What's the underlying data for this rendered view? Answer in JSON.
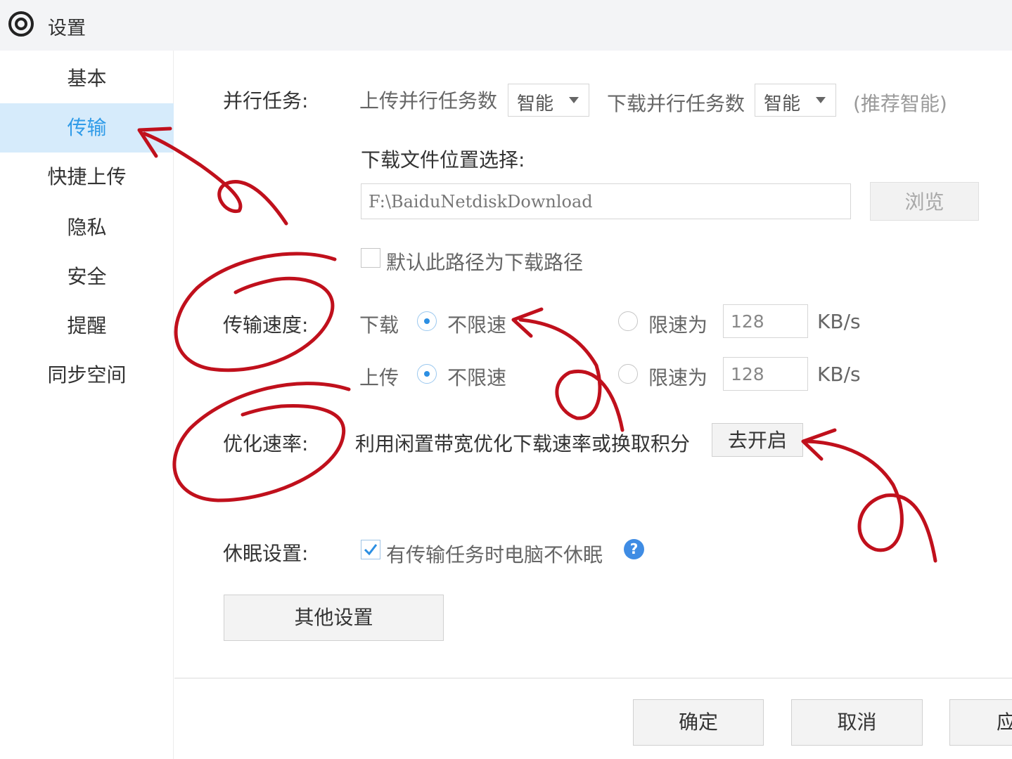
{
  "window": {
    "title": "设置"
  },
  "sidebar": {
    "items": [
      {
        "label": "基本",
        "active": false
      },
      {
        "label": "传输",
        "active": true
      },
      {
        "label": "快捷上传",
        "active": false
      },
      {
        "label": "隐私",
        "active": false
      },
      {
        "label": "安全",
        "active": false
      },
      {
        "label": "提醒",
        "active": false
      },
      {
        "label": "同步空间",
        "active": false
      }
    ]
  },
  "parallel": {
    "label": "并行任务:",
    "upload_label": "上传并行任务数",
    "upload_value": "智能",
    "download_label": "下载并行任务数",
    "download_value": "智能",
    "hint": "(推荐智能)"
  },
  "download_location": {
    "label": "下载文件位置选择:",
    "path": "F:\\BaiduNetdiskDownload",
    "browse_button": "浏览",
    "default_checkbox_label": "默认此路径为下载路径",
    "default_checked": false
  },
  "speed": {
    "label": "传输速度:",
    "download": {
      "label": "下载",
      "unlimited_label": "不限速",
      "limit_label": "限速为",
      "limit_value": "128",
      "unit": "KB/s",
      "selected": "unlimited"
    },
    "upload": {
      "label": "上传",
      "unlimited_label": "不限速",
      "limit_label": "限速为",
      "limit_value": "128",
      "unit": "KB/s",
      "selected": "unlimited"
    }
  },
  "optimize": {
    "label": "优化速率:",
    "description": "利用闲置带宽优化下载速率或换取积分",
    "button": "去开启"
  },
  "sleep": {
    "label": "休眠设置:",
    "checkbox_label": "有传输任务时电脑不休眠",
    "checked": true,
    "help_icon": "?"
  },
  "other_settings_button": "其他设置",
  "footer": {
    "ok": "确定",
    "cancel": "取消",
    "apply": "应用"
  },
  "colors": {
    "accent": "#2f9be8",
    "active_bg": "#d6ebfb",
    "annotation": "#c0101c"
  }
}
